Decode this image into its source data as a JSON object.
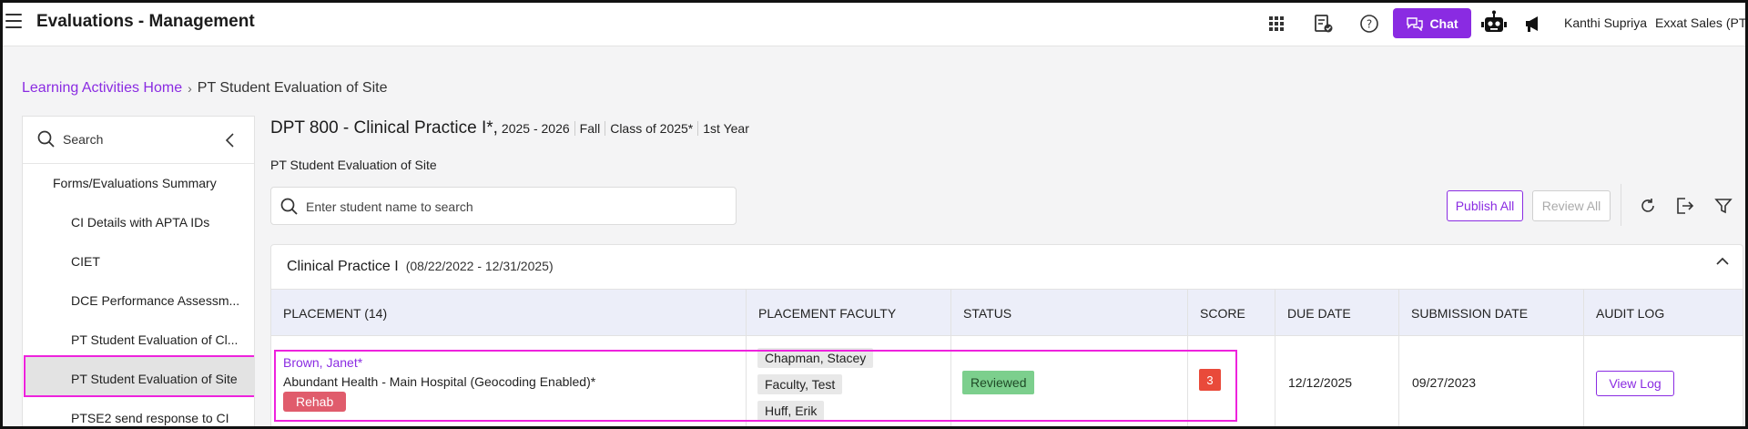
{
  "header": {
    "title": "Evaluations - Management",
    "chat_label": "Chat",
    "user_name": "Kanthi Supriya",
    "org_name": "Exxat Sales (PT)",
    "icons": [
      "menu-icon",
      "apps-grid-icon",
      "checklist-icon",
      "help-icon",
      "chat-bubble-icon",
      "robot-icon",
      "megaphone-icon"
    ]
  },
  "breadcrumb": {
    "home": "Learning Activities Home",
    "separator": "›",
    "current": "PT Student Evaluation of Site"
  },
  "sidebar": {
    "search_label": "Search",
    "items": [
      {
        "label": "Forms/Evaluations Summary"
      },
      {
        "label": "CI Details with APTA IDs"
      },
      {
        "label": "CIET"
      },
      {
        "label": "DCE Performance Assessm..."
      },
      {
        "label": "PT Student Evaluation of Cl..."
      },
      {
        "label": "PT Student Evaluation of Site",
        "active": true
      },
      {
        "label": "PTSE2 send response to CI"
      }
    ]
  },
  "course": {
    "name": "DPT 800 - Clinical Practice I*,",
    "year": "2025 - 2026",
    "term": "Fall",
    "class": "Class of 2025*",
    "level": "1st Year"
  },
  "page_subtitle": "PT Student Evaluation of Site",
  "student_search": {
    "placeholder": "Enter student name to search"
  },
  "actions": {
    "publish_all": "Publish All",
    "review_all": "Review All",
    "icons": [
      "refresh-icon",
      "export-icon",
      "filter-icon"
    ]
  },
  "section": {
    "name": "Clinical Practice I",
    "dates": "(08/22/2022 - 12/31/2025)"
  },
  "table": {
    "columns": [
      "PLACEMENT (14)",
      "PLACEMENT FACULTY",
      "STATUS",
      "SCORE",
      "DUE DATE",
      "SUBMISSION DATE",
      "AUDIT LOG"
    ],
    "rows": [
      {
        "student": "Brown, Janet*",
        "site": "Abundant Health - Main Hospital (Geocoding Enabled)*",
        "tag": "Rehab",
        "faculty": [
          "Chapman,  Stacey",
          "Faculty,  Test",
          "Huff,  Erik"
        ],
        "status": "Reviewed",
        "score": "3",
        "due_date": "12/12/2025",
        "submission_date": "09/27/2023",
        "audit_log": "View Log"
      }
    ]
  },
  "colors": {
    "accent": "#8a2be2",
    "highlight": "#ee22dd",
    "status_reviewed": "#7ccf8d",
    "score_bad": "#e94a3a",
    "tag_rehab": "#e05c6c"
  }
}
